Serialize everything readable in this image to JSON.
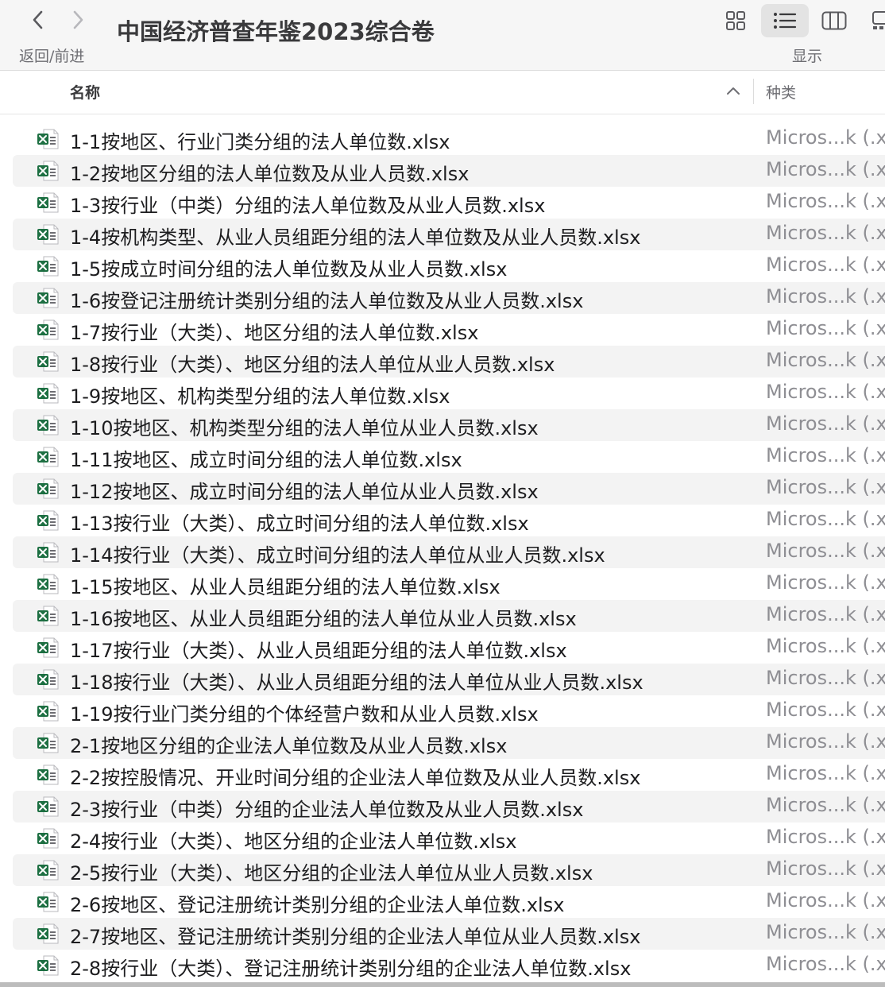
{
  "toolbar": {
    "title": "中国经济普查年鉴2023综合卷",
    "nav_label": "返回/前进",
    "view_label": "显示",
    "back_icon": "chevron-left-icon",
    "forward_icon": "chevron-right-icon"
  },
  "columns": {
    "name": "名称",
    "kind": "种类"
  },
  "files": [
    {
      "name": "1-1按地区、行业门类分组的法人单位数.xlsx",
      "kind": "Micros...k (.x"
    },
    {
      "name": "1-2按地区分组的法人单位数及从业人员数.xlsx",
      "kind": "Micros...k (.x"
    },
    {
      "name": "1-3按行业（中类）分组的法人单位数及从业人员数.xlsx",
      "kind": "Micros...k (.x"
    },
    {
      "name": "1-4按机构类型、从业人员组距分组的法人单位数及从业人员数.xlsx",
      "kind": "Micros...k (.x"
    },
    {
      "name": "1-5按成立时间分组的法人单位数及从业人员数.xlsx",
      "kind": "Micros...k (.x"
    },
    {
      "name": "1-6按登记注册统计类别分组的法人单位数及从业人员数.xlsx",
      "kind": "Micros...k (.x"
    },
    {
      "name": "1-7按行业（大类）、地区分组的法人单位数.xlsx",
      "kind": "Micros...k (.x"
    },
    {
      "name": "1-8按行业（大类）、地区分组的法人单位从业人员数.xlsx",
      "kind": "Micros...k (.x"
    },
    {
      "name": "1-9按地区、机构类型分组的法人单位数.xlsx",
      "kind": "Micros...k (.x"
    },
    {
      "name": "1-10按地区、机构类型分组的法人单位从业人员数.xlsx",
      "kind": "Micros...k (.x"
    },
    {
      "name": "1-11按地区、成立时间分组的法人单位数.xlsx",
      "kind": "Micros...k (.x"
    },
    {
      "name": "1-12按地区、成立时间分组的法人单位从业人员数.xlsx",
      "kind": "Micros...k (.x"
    },
    {
      "name": "1-13按行业（大类）、成立时间分组的法人单位数.xlsx",
      "kind": "Micros...k (.x"
    },
    {
      "name": "1-14按行业（大类）、成立时间分组的法人单位从业人员数.xlsx",
      "kind": "Micros...k (.x"
    },
    {
      "name": "1-15按地区、从业人员组距分组的法人单位数.xlsx",
      "kind": "Micros...k (.x"
    },
    {
      "name": "1-16按地区、从业人员组距分组的法人单位从业人员数.xlsx",
      "kind": "Micros...k (.x"
    },
    {
      "name": "1-17按行业（大类）、从业人员组距分组的法人单位数.xlsx",
      "kind": "Micros...k (.x"
    },
    {
      "name": "1-18按行业（大类）、从业人员组距分组的法人单位从业人员数.xlsx",
      "kind": "Micros...k (.x"
    },
    {
      "name": "1-19按行业门类分组的个体经营户数和从业人员数.xlsx",
      "kind": "Micros...k (.x"
    },
    {
      "name": "2-1按地区分组的企业法人单位数及从业人员数.xlsx",
      "kind": "Micros...k (.x"
    },
    {
      "name": "2-2按控股情况、开业时间分组的企业法人单位数及从业人员数.xlsx",
      "kind": "Micros...k (.x"
    },
    {
      "name": "2-3按行业（中类）分组的企业法人单位数及从业人员数.xlsx",
      "kind": "Micros...k (.x"
    },
    {
      "name": "2-4按行业（大类）、地区分组的企业法人单位数.xlsx",
      "kind": "Micros...k (.x"
    },
    {
      "name": "2-5按行业（大类）、地区分组的企业法人单位从业人员数.xlsx",
      "kind": "Micros...k (.x"
    },
    {
      "name": "2-6按地区、登记注册统计类别分组的企业法人单位数.xlsx",
      "kind": "Micros...k (.x"
    },
    {
      "name": "2-7按地区、登记注册统计类别分组的企业法人单位从业人员数.xlsx",
      "kind": "Micros...k (.x"
    },
    {
      "name": "2-8按行业（大类）、登记注册统计类别分组的企业法人单位数.xlsx",
      "kind": "Micros...k (.x"
    }
  ],
  "colors": {
    "excel_green": "#1d6f42",
    "row_stripe": "#f3f3f3",
    "toolbar_bg": "#f6f6f6"
  }
}
